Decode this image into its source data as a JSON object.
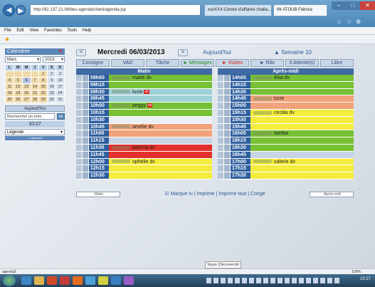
{
  "browser": {
    "address": "http://92.137.21.98/bes-agenda/client/agenda.jsp",
    "tabs": [
      "xxxXXX-Centre d'affaires challa...",
      "Mr ATOUB Fabrice"
    ],
    "menu": [
      "File",
      "Edit",
      "View",
      "Favorites",
      "Tools",
      "Help"
    ]
  },
  "sidebar": {
    "title": "Calendrier",
    "month": "Mars",
    "year": "2013",
    "weekdays": [
      "L",
      "M",
      "M",
      "J",
      "V",
      "S",
      "D"
    ],
    "weeks": [
      [
        "",
        "",
        "",
        "",
        "1",
        "2",
        "3"
      ],
      [
        "4",
        "5",
        "6",
        "7",
        "8",
        "9",
        "10"
      ],
      [
        "11",
        "12",
        "13",
        "14",
        "15",
        "16",
        "17"
      ],
      [
        "18",
        "19",
        "20",
        "21",
        "22",
        "23",
        "24"
      ],
      [
        "25",
        "26",
        "27",
        "28",
        "29",
        "30",
        "31"
      ]
    ],
    "today_button": "Aujourd'hui",
    "search_placeholder": "Rechercher un nom",
    "search_go": "ok",
    "time": "10:27",
    "legend": "Légende",
    "agenda_bar": "<< Agenda3"
  },
  "schedule": {
    "date": "Mercredi 06/03/2013",
    "today": "Aujourd'hui",
    "week": "▲ Semaine 10",
    "prev": "<",
    "next": ">",
    "tabs": [
      "Consigne",
      "VAD",
      "Tâche",
      "► Messages",
      "► Visites",
      "► Rdv",
      "0 Attente(s)",
      "Libre"
    ],
    "morning_title": "Matin",
    "afternoon_title": "Après-midi",
    "morning": [
      {
        "time": "09h00",
        "text": "maïté dv",
        "color": "g",
        "blur": true
      },
      {
        "time": "09h15",
        "text": "",
        "color": "g"
      },
      {
        "time": "09h30",
        "text": "lucie",
        "color": "c",
        "blur": true,
        "tag": "ok"
      },
      {
        "time": "09h45",
        "text": "",
        "color": "c"
      },
      {
        "time": "10h00",
        "text": "peggy",
        "color": "g",
        "blur": true,
        "tag": "ok"
      },
      {
        "time": "10h15",
        "text": "",
        "color": "g"
      },
      {
        "time": "10h30",
        "text": "",
        "color": "w"
      },
      {
        "time": "10h45",
        "text": "amélie dv",
        "color": "o",
        "blur": true
      },
      {
        "time": "11h00",
        "text": "",
        "color": "o"
      },
      {
        "time": "11h15",
        "text": "",
        "color": "b"
      },
      {
        "time": "11h30",
        "text": "patricia dv",
        "color": "r",
        "blur": true
      },
      {
        "time": "11h45",
        "text": "",
        "color": "r"
      },
      {
        "time": "12h00",
        "text": "ophélie dv",
        "color": "y",
        "blur": true
      },
      {
        "time": "12h15",
        "text": "",
        "color": "y"
      },
      {
        "time": "12h30",
        "text": "",
        "color": "y"
      }
    ],
    "afternoon": [
      {
        "time": "14h00",
        "text": "élsa dv",
        "color": "g",
        "blur": true
      },
      {
        "time": "14h15",
        "text": "",
        "color": "g"
      },
      {
        "time": "14h30",
        "text": "",
        "color": "g"
      },
      {
        "time": "14h45",
        "text": "lucie",
        "color": "o",
        "blur": true
      },
      {
        "time": "15h00",
        "text": "",
        "color": "o"
      },
      {
        "time": "15h15",
        "text": "cecilia dv",
        "color": "y",
        "blur": true
      },
      {
        "time": "15h30",
        "text": "",
        "color": "y"
      },
      {
        "time": "15h45",
        "text": "",
        "color": "y"
      },
      {
        "time": "16h00",
        "text": "laetitia",
        "color": "g",
        "blur": true
      },
      {
        "time": "16h15",
        "text": "",
        "color": "g"
      },
      {
        "time": "16h30",
        "text": "",
        "color": "g"
      },
      {
        "time": "16h45",
        "text": "",
        "color": "b"
      },
      {
        "time": "17h00",
        "text": "valerie dv",
        "color": "y",
        "blur": true
      },
      {
        "time": "17h15",
        "text": "",
        "color": "y"
      },
      {
        "time": "17h30",
        "text": "",
        "color": "y"
      }
    ],
    "footer": "☑ Marque lu | Imprime | Imprime tout | Congé",
    "left_select": "Matin",
    "right_select": "Après-midi"
  },
  "status": {
    "left": "agenda3",
    "zoom": "100%",
    "clock": "10:27",
    "notice": "Skype (Déconnecté)"
  }
}
